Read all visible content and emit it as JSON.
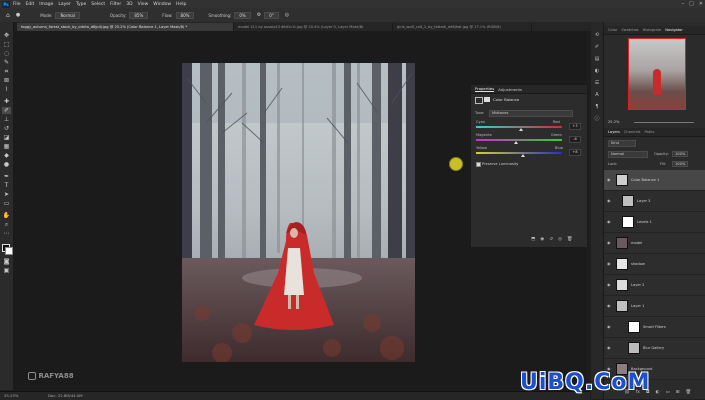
{
  "menu": [
    "File",
    "Edit",
    "Image",
    "Layer",
    "Type",
    "Select",
    "Filter",
    "3D",
    "View",
    "Window",
    "Help"
  ],
  "app_logo": "Ps",
  "options_bar": {
    "mode_label": "Mode:",
    "mode_value": "Normal",
    "opacity_label": "Opacity:",
    "opacity_value": "85%",
    "flow_label": "Flow:",
    "flow_value": "80%",
    "smoothing_label": "Smoothing:",
    "smoothing_value": "0%",
    "angle_value": "0°"
  },
  "tabs": [
    {
      "label": "foggy_autumn_forest_stock_by_orbita_d6jp4j.jpg @ 25.2% (Color Balance 1, Layer Mask/8) *",
      "active": true
    },
    {
      "label": "model 211 by assaiu43 d6d1c1t.jpg @ 20.4% (Layer 0, Layer Mask/8)",
      "active": false
    },
    {
      "label": "girls_wolf_colt_2_by_fattedi_dd6jhat.jpg @ 17.1% (RGB/8)",
      "active": false
    }
  ],
  "properties": {
    "tabs": [
      "Properties",
      "Adjustments"
    ],
    "title": "Color Balance",
    "tone_label": "Tone:",
    "tone_value": "Midtones",
    "sliders": [
      {
        "left": "Cyan",
        "right": "Red",
        "value": "+3",
        "position": 0.52
      },
      {
        "left": "Magenta",
        "right": "Green",
        "value": "-6",
        "position": 0.46
      },
      {
        "left": "Yellow",
        "right": "Blue",
        "value": "+8",
        "position": 0.55
      }
    ],
    "preserve_label": "Preserve Luminosity"
  },
  "navigator": {
    "tabs": [
      "Color",
      "Swatches",
      "Histogram",
      "Navigator"
    ],
    "zoom": "25.2%"
  },
  "layers_panel": {
    "tabs": [
      "Layers",
      "Channels",
      "Paths"
    ],
    "kind": "Kind",
    "blend_mode": "Normal",
    "opacity_label": "Opacity:",
    "opacity_value": "100%",
    "lock_label": "Lock:",
    "fill_label": "Fill:",
    "fill_value": "100%",
    "layers": [
      {
        "name": "Color Balance 1",
        "selected": true,
        "indent": 0
      },
      {
        "name": "Layer 3",
        "selected": false,
        "indent": 1
      },
      {
        "name": "Levels 1",
        "selected": false,
        "indent": 1
      },
      {
        "name": "model",
        "selected": false,
        "indent": 0
      },
      {
        "name": "shadow",
        "selected": false,
        "indent": 0
      },
      {
        "name": "Layer 2",
        "selected": false,
        "indent": 0
      },
      {
        "name": "Layer 1",
        "selected": false,
        "indent": 0
      },
      {
        "name": "Smart Filters",
        "selected": false,
        "indent": 2
      },
      {
        "name": "Blur Gallery",
        "selected": false,
        "indent": 2
      },
      {
        "name": "Background",
        "selected": false,
        "indent": 0
      }
    ]
  },
  "status": {
    "zoom": "25.25%",
    "doc": "Doc: 22.8M/44.0M"
  },
  "overlay": {
    "channel_name": "RAFYA88",
    "site_watermark": "UiBQ.CoM"
  },
  "colors": {
    "accent_red": "#d23a3a",
    "ps_blue": "#31a8ff",
    "watermark_blue": "#1b4fd1"
  }
}
